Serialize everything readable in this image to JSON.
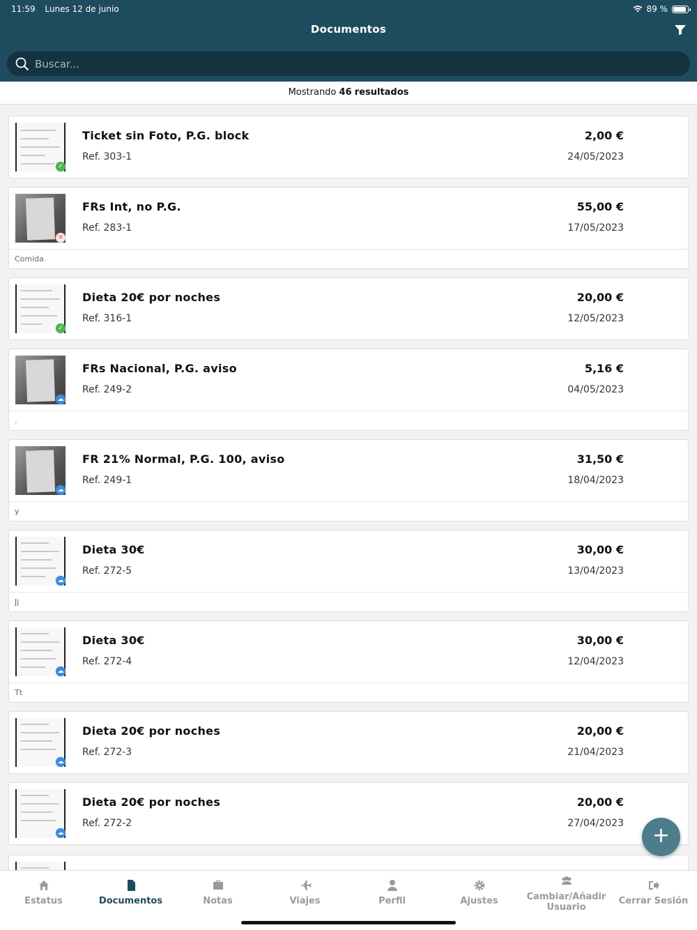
{
  "status_bar": {
    "time": "11:59",
    "date": "Lunes 12 de junio",
    "battery": "89 %"
  },
  "header": {
    "title": "Documentos"
  },
  "search": {
    "placeholder": "Buscar..."
  },
  "results": {
    "prefix": "Mostrando",
    "count": "46",
    "suffix": "resultados"
  },
  "documents": [
    {
      "title": "Ticket sin Foto, P.G. block",
      "ref": "Ref. 303-1",
      "amount": "2,00 €",
      "date": "24/05/2023",
      "status": "ok",
      "note": ""
    },
    {
      "title": "FRs Int, no P.G.",
      "ref": "Ref. 283-1",
      "amount": "55,00 €",
      "date": "17/05/2023",
      "status": "error",
      "note": "Comida"
    },
    {
      "title": "Dieta 20€ por noches",
      "ref": "Ref. 316-1",
      "amount": "20,00 €",
      "date": "12/05/2023",
      "status": "ok",
      "note": ""
    },
    {
      "title": "FRs Nacional, P.G. aviso",
      "ref": "Ref. 249-2",
      "amount": "5,16 €",
      "date": "04/05/2023",
      "status": "cloud",
      "note": "."
    },
    {
      "title": "FR 21% Normal, P.G. 100, aviso",
      "ref": "Ref. 249-1",
      "amount": "31,50 €",
      "date": "18/04/2023",
      "status": "cloud",
      "note": "y"
    },
    {
      "title": "Dieta 30€",
      "ref": "Ref. 272-5",
      "amount": "30,00 €",
      "date": "13/04/2023",
      "status": "cloud",
      "note": "Jj"
    },
    {
      "title": "Dieta 30€",
      "ref": "Ref. 272-4",
      "amount": "30,00 €",
      "date": "12/04/2023",
      "status": "cloud",
      "note": "Tt"
    },
    {
      "title": "Dieta 20€ por noches",
      "ref": "Ref. 272-3",
      "amount": "20,00 €",
      "date": "21/04/2023",
      "status": "cloud",
      "note": ""
    },
    {
      "title": "Dieta 20€ por noches",
      "ref": "Ref. 272-2",
      "amount": "20,00 €",
      "date": "27/04/2023",
      "status": "cloud",
      "note": ""
    }
  ],
  "fab": {
    "label": "+"
  },
  "tabs": [
    {
      "label": "Estatus",
      "icon": "home-icon"
    },
    {
      "label": "Documentos",
      "icon": "document-icon"
    },
    {
      "label": "Notas",
      "icon": "briefcase-icon"
    },
    {
      "label": "Viajes",
      "icon": "plane-icon"
    },
    {
      "label": "Perfil",
      "icon": "user-icon"
    },
    {
      "label": "Ajustes",
      "icon": "gear-icon"
    },
    {
      "label": "Cambiar/Añadir Usuario",
      "icon": "users-icon"
    },
    {
      "label": "Cerrar Sesión",
      "icon": "logout-icon"
    }
  ],
  "colors": {
    "header": "#1f4b5e",
    "accent": "#1f4b5e",
    "fab": "#4d7c8a"
  }
}
